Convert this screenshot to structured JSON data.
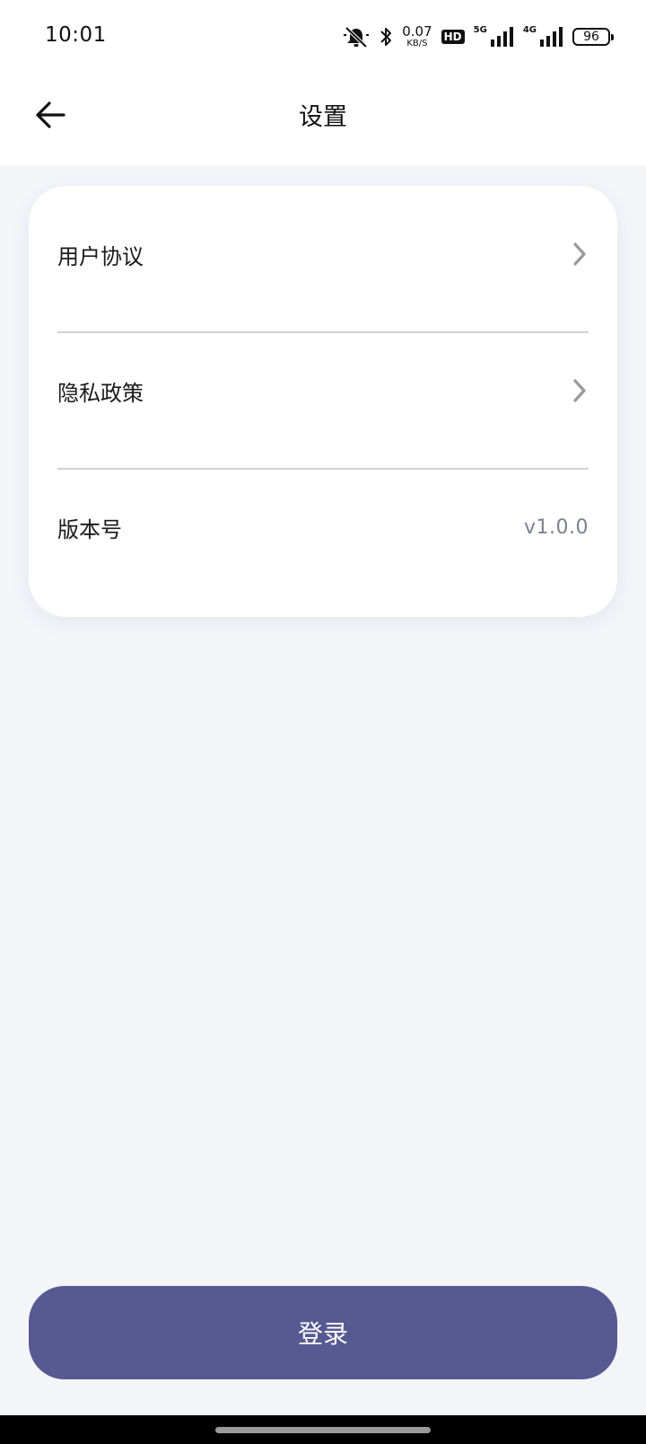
{
  "status_bar": {
    "time": "10:01",
    "net_speed_value": "0.07",
    "net_speed_unit": "KB/S",
    "hd_label": "HD",
    "signal_1_label": "5G",
    "signal_2_label": "4G",
    "battery_level": "96",
    "icons": [
      "mute-icon",
      "bluetooth-icon",
      "hd-icon",
      "signal-5g-icon",
      "signal-4g-icon",
      "battery-icon"
    ]
  },
  "header": {
    "title": "设置",
    "back_icon": "arrow-left-icon"
  },
  "settings": {
    "items": [
      {
        "label": "用户协议",
        "icon": "chevron-right-icon"
      },
      {
        "label": "隐私政策",
        "icon": "chevron-right-icon"
      },
      {
        "label": "版本号",
        "value": "v1.0.0"
      }
    ]
  },
  "login_button": {
    "label": "登录"
  },
  "colors": {
    "background": "#f3f5f9",
    "card": "#ffffff",
    "primary_button": "#575993",
    "chevron": "#9a9a9a",
    "version_text": "#7a8190"
  }
}
